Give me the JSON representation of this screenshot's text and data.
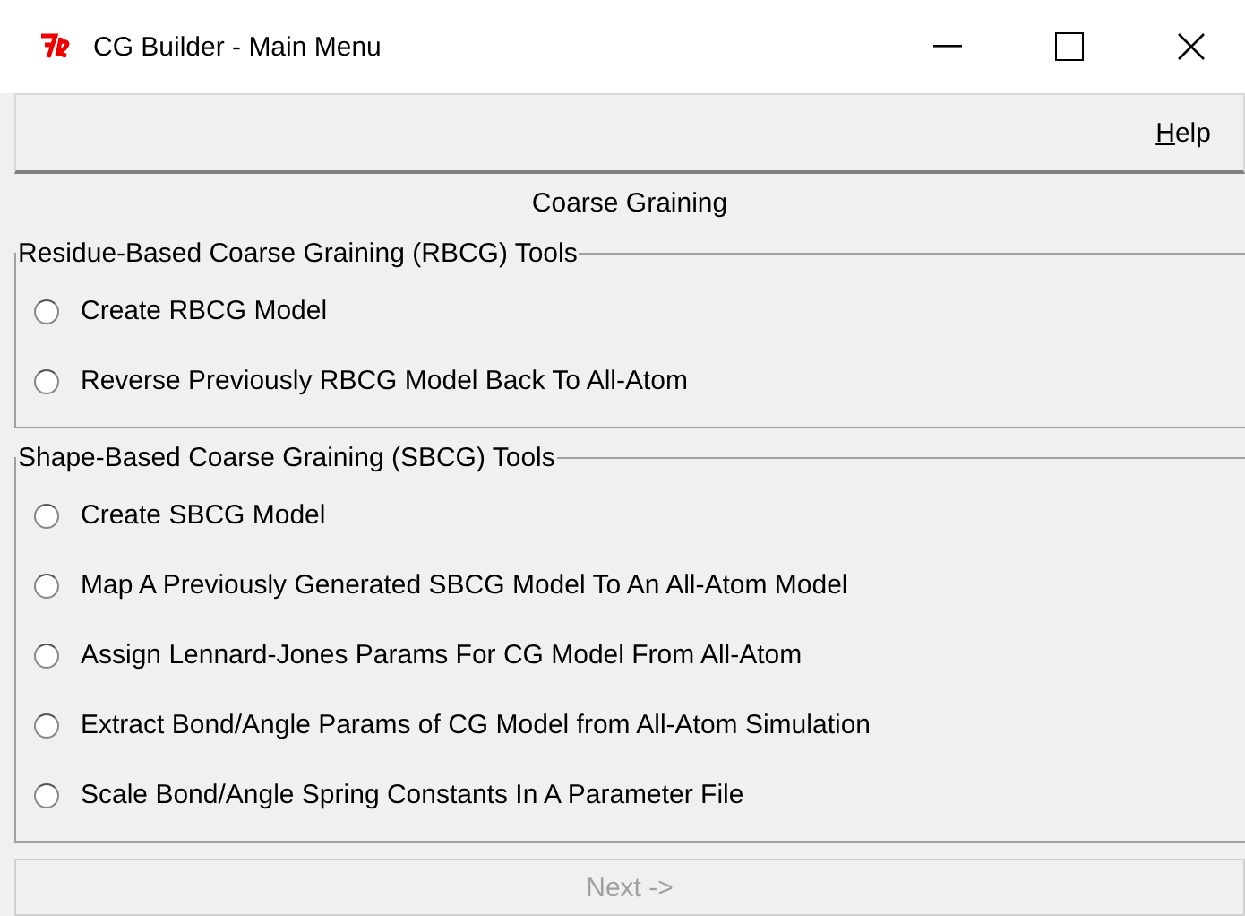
{
  "window": {
    "title": "CG Builder - Main Menu"
  },
  "menu": [
    {
      "label": "Help"
    }
  ],
  "heading": "Coarse Graining",
  "groups": [
    {
      "title": "Residue-Based Coarse Graining (RBCG) Tools",
      "options": [
        {
          "label": "Create RBCG Model",
          "selected": false
        },
        {
          "label": "Reverse Previously RBCG Model Back To All-Atom",
          "selected": false
        }
      ]
    },
    {
      "title": "Shape-Based Coarse Graining (SBCG) Tools",
      "options": [
        {
          "label": "Create SBCG Model",
          "selected": false
        },
        {
          "label": "Map A Previously Generated SBCG Model To An All-Atom Model",
          "selected": false
        },
        {
          "label": "Assign Lennard-Jones Params For CG Model From All-Atom",
          "selected": false
        },
        {
          "label": "Extract Bond/Angle Params of CG Model from All-Atom Simulation",
          "selected": false
        },
        {
          "label": "Scale Bond/Angle Spring Constants In A Parameter File",
          "selected": false
        }
      ]
    }
  ],
  "next_button": {
    "label": "Next ->",
    "disabled": true
  }
}
